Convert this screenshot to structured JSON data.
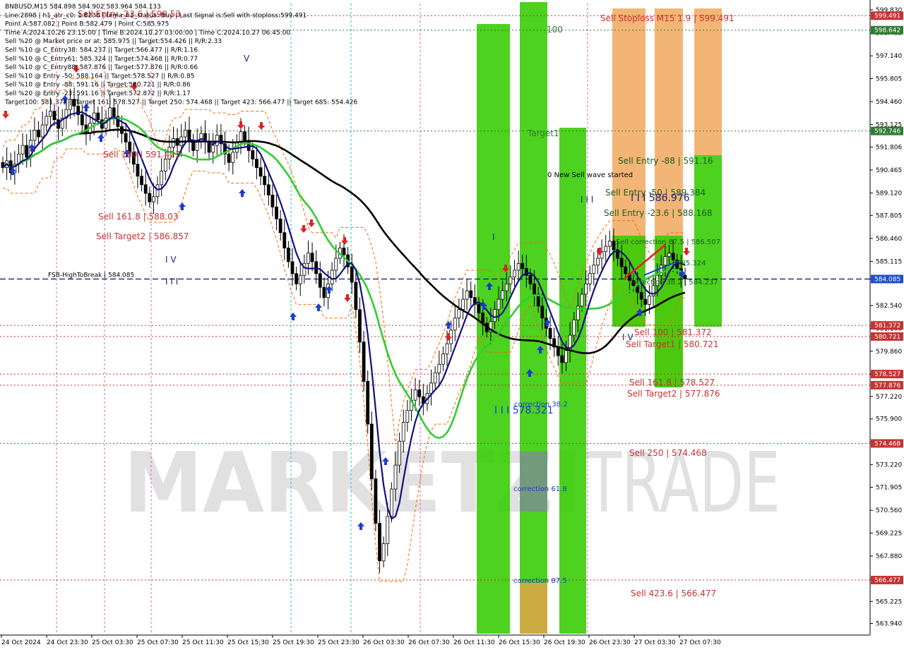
{
  "header": {
    "lines": [
      "BNBUSD,M15  584.898 584.902 583.964 584.133",
      "Line:2898  | h1_atr_c0: 1.8238 | tema_h1_status: Buy | Last Signal is:Sell with stoploss:599.491",
      "Point A:587.082 | Point B:582.479 | Point C:585.975",
      "Time A:2024.10.26 23:15:00 | Time B:2024.10.27 03:00:00 | Time C:2024.10.27 06:45:00",
      "Sell %20 @ Market price or at: 585.975 || Target:554.426 || R/R:2.33",
      "Sell %10 @ C_Entry38: 584.237 || Target:566.477 || R/R:1.16",
      "Sell %10 @ C_Entry61: 585.324 || Target:574.468 || R/R:0.77",
      "Sell %10 @ C_Entry88: 587.876 || Target:577.876 || R/R:0.66",
      "Sell %10 @ Entry -50: 588.164 || Target:578.527 || R/R:0.85",
      "Sell %10 @ Entry -88: 591.16 || Target:580.721 || R/R:0.86",
      "Sell %20 @ Entry -23: 591.16 || Target:572.872 || R/R:1.17",
      "Target100: 581.372 || Target 161: 578.527 || Target 250: 574.468 || Target 423: 566.477 || Target 685: 554.426"
    ]
  },
  "chart_data": {
    "type": "candlestick",
    "symbol": "BNBUSD",
    "timeframe": "M15",
    "ohlc_header": {
      "open": 584.898,
      "high": 584.902,
      "low": 583.964,
      "close": 584.133
    },
    "ylim": [
      563.3,
      600.2
    ],
    "y_ticks": [
      "599.830",
      "598.485",
      "597.140",
      "595.805",
      "594.460",
      "593.125",
      "591.806",
      "590.465",
      "589.120",
      "587.805",
      "586.460",
      "585.115",
      "584.085",
      "582.540",
      "581.195",
      "579.860",
      "578.515",
      "577.220",
      "575.900",
      "574.565",
      "573.220",
      "571.905",
      "570.560",
      "569.225",
      "567.880",
      "566.545",
      "565.225",
      "563.940"
    ],
    "x_ticks": [
      "24 Oct 2024",
      "24 Oct 23:30",
      "25 Oct 03:30",
      "25 Oct 07:30",
      "25 Oct 11:30",
      "25 Oct 15:30",
      "25 Oct 19:30",
      "25 Oct 23:30",
      "26 Oct 03:30",
      "26 Oct 07:30",
      "26 Oct 11:30",
      "26 Oct 15:30",
      "26 Oct 19:30",
      "26 Oct 23:30",
      "27 Oct 03:30",
      "27 Oct 07:30"
    ],
    "closes": [
      590.6,
      591.0,
      590.3,
      590.8,
      591.4,
      591.9,
      591.2,
      592.2,
      592.8,
      592.4,
      593.1,
      593.6,
      593.9,
      593.4,
      592.9,
      593.5,
      594.0,
      594.6,
      594.2,
      593.7,
      593.1,
      592.6,
      593.2,
      593.8,
      593.4,
      592.9,
      593.5,
      594.1,
      593.6,
      593.0,
      592.6,
      592.1,
      591.5,
      590.8,
      590.1,
      589.6,
      589.1,
      588.6,
      588.9,
      589.6,
      590.4,
      591.1,
      591.8,
      592.3,
      591.9,
      592.4,
      592.8,
      592.2,
      591.6,
      592.1,
      592.6,
      592.1,
      591.5,
      591.9,
      592.5,
      592.0,
      591.4,
      590.9,
      591.5,
      592.1,
      592.7,
      592.2,
      591.6,
      591.1,
      590.6,
      590.1,
      589.6,
      589.0,
      588.3,
      587.6,
      586.8,
      585.9,
      585.1,
      584.4,
      583.8,
      584.3,
      585.0,
      585.6,
      585.1,
      584.4,
      583.6,
      583.0,
      583.8,
      584.6,
      585.3,
      585.9,
      585.5,
      584.8,
      583.9,
      582.3,
      580.4,
      578.1,
      575.6,
      572.4,
      569.8,
      567.6,
      568.6,
      570.2,
      571.8,
      573.2,
      574.6,
      575.7,
      576.4,
      577.0,
      577.6,
      577.2,
      576.8,
      577.4,
      578.0,
      578.6,
      579.1,
      579.7,
      580.3,
      581.1,
      581.8,
      582.3,
      582.9,
      583.4,
      583.0,
      582.6,
      582.1,
      581.5,
      581.0,
      581.6,
      582.3,
      582.9,
      583.4,
      583.8,
      584.2,
      584.6,
      585.0,
      584.7,
      584.3,
      583.8,
      583.2,
      582.5,
      581.8,
      581.2,
      580.6,
      580.1,
      579.6,
      579.2,
      579.9,
      580.8,
      581.7,
      582.5,
      583.2,
      583.8,
      584.4,
      584.9,
      585.3,
      585.7,
      586.0,
      586.3,
      585.8,
      585.3,
      584.8,
      584.4,
      584.0,
      583.7,
      583.3,
      582.9,
      582.6,
      583.1,
      583.7,
      584.3,
      584.9,
      585.4,
      585.6,
      585.2,
      584.7,
      584.3,
      584.1
    ]
  },
  "levels": [
    {
      "label": "Sell Stoploss M15 1.9 | 599.491",
      "value": 599.491,
      "price": "599.491",
      "color": "#c83232"
    },
    {
      "label": "100",
      "value": 598.642,
      "price": "598.642",
      "color": "#2e7d32"
    },
    {
      "label": "Target1",
      "value": 592.746,
      "price": "592.746",
      "color": "#2e7d32"
    },
    {
      "label": "FSB-HighToBreak | 584.085",
      "value": 584.085,
      "price": "584.085",
      "color": "#1a237e"
    },
    {
      "label": "Sell 100 | 581.372",
      "value": 581.372,
      "price": "581.372",
      "color": "#c83232"
    },
    {
      "label": "Sell Target1 | 580.721",
      "value": 580.721,
      "price": "580.721",
      "color": "#c83232"
    },
    {
      "label": "Sell 161.8 | 578.527",
      "value": 578.527,
      "price": "578.527",
      "color": "#c83232"
    },
    {
      "label": "Sell Target2 | 577.876",
      "value": 577.876,
      "price": "577.876",
      "color": "#c83232"
    },
    {
      "label": "Sell 250 | 574.468",
      "value": 574.468,
      "price": "574.468",
      "color": "#c83232"
    },
    {
      "label": "Sell 423.6 | 566.477",
      "value": 566.477,
      "price": "566.477",
      "color": "#c83232"
    }
  ],
  "annotations": {
    "sell_entry_top": "Sell Entry -23.6 | 599.53",
    "sell_100_left": "Sell 100 | 591.423",
    "sell_1618_left": "Sell 161.8 | 588.03",
    "sell_target2_left": "Sell Target2 | 586.857",
    "wave_v": "V",
    "wave_iv": "I V",
    "wave_iii_left": "I I I",
    "sell_entry_88": "Sell Entry -88 | 591.16",
    "new_wave": "0 New Sell wave started",
    "sell_entry_50": "Sell Entry -50 | 589.384",
    "wave_iii_right": "I I I",
    "price_586976": "I I I 586.976",
    "sell_entry_236": "Sell Entry -23.6 | 588.168",
    "sell_corr_875": "Sell correction 87.5 | 586.507",
    "sell_corr_price": "585.324",
    "sell_corr_382": "correction 38.2 | 584.237",
    "wave_i": "I",
    "wave_iv_right": "I V",
    "corr_382": "correction 38.2",
    "price_578321": "I I I 578.321",
    "corr_618": "correction 61.8",
    "corr_875": "correction 87.5"
  },
  "watermark": {
    "text_left": "MARKETZI",
    "text_right": "TRADE"
  },
  "colors": {
    "green_zone": "#33cc00",
    "orange_zone": "#f0a050",
    "gray_zone": "#808a99",
    "ma_black": "#000000",
    "ma_green": "#33cc33",
    "ma_navy": "#101080",
    "channel_orange": "#ff6600",
    "arrow_up": "#1a3cd0",
    "arrow_down": "#e02020",
    "fsb_line": "#1a237e",
    "price_tag_bg": "#1a4fd0"
  }
}
